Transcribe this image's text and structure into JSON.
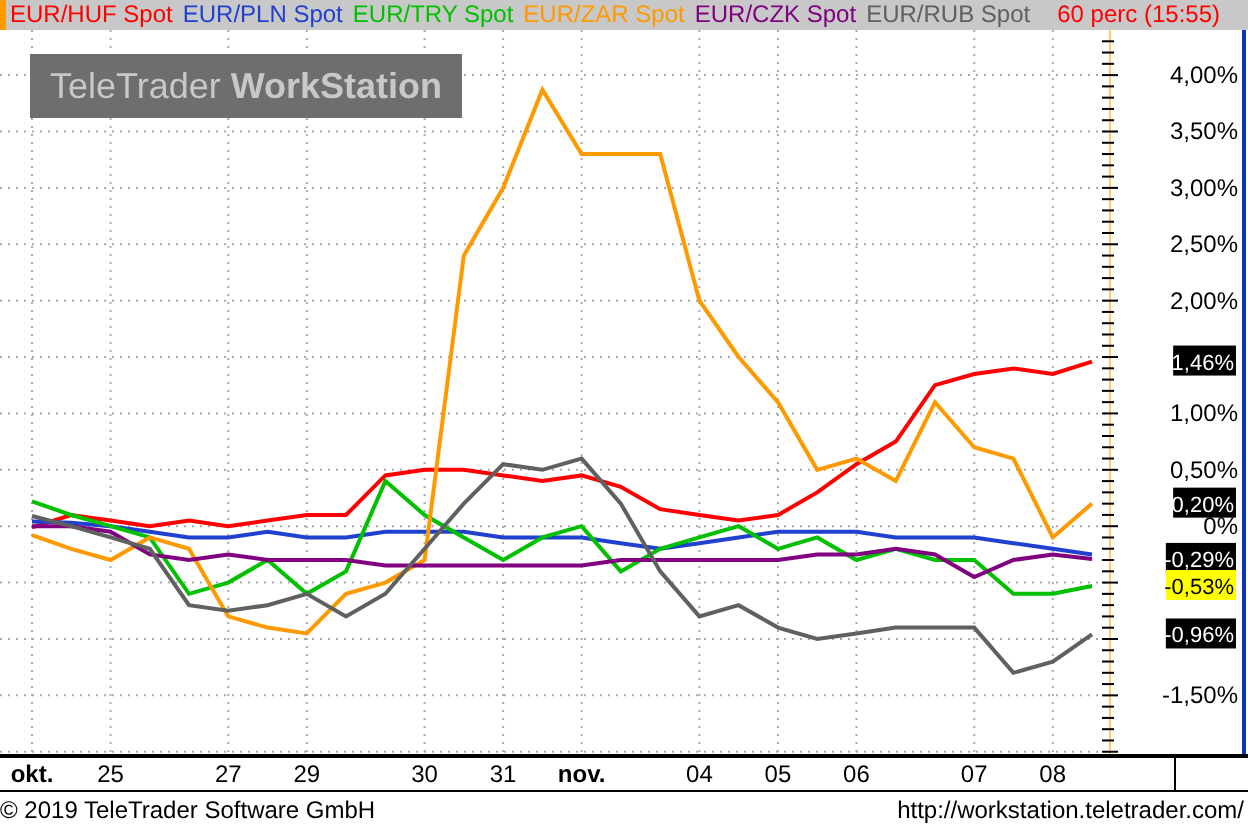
{
  "legend": {
    "interval": "60 perc (15:55)"
  },
  "logo": "TeleTrader **WorkStation**",
  "chart_data": {
    "type": "line",
    "grid": true,
    "categories": [
      "okt.",
      null,
      "25",
      null,
      null,
      "27",
      null,
      "29",
      null,
      null,
      "30",
      null,
      "31",
      null,
      "nov.",
      null,
      null,
      "04",
      null,
      "05",
      null,
      "06",
      null,
      null,
      "07",
      null,
      "08",
      null
    ],
    "series": [
      {
        "name": "EUR/HUF Spot",
        "color": "#ff0000",
        "values": [
          -0.01,
          0.1,
          0.05,
          0,
          0.05,
          0,
          0.05,
          0.1,
          0.1,
          0.45,
          0.5,
          0.5,
          0.45,
          0.4,
          0.45,
          0.35,
          0.15,
          0.1,
          0.05,
          0.1,
          0.3,
          0.55,
          0.75,
          1.25,
          1.35,
          1.4,
          1.35,
          1.46
        ]
      },
      {
        "name": "EUR/PLN Spot",
        "color": "#2040d0",
        "values": [
          0.04,
          0.03,
          0,
          -0.05,
          -0.1,
          -0.1,
          -0.05,
          -0.1,
          -0.1,
          -0.05,
          -0.05,
          -0.05,
          -0.1,
          -0.1,
          -0.1,
          -0.15,
          -0.2,
          -0.15,
          -0.1,
          -0.05,
          -0.05,
          -0.05,
          -0.1,
          -0.1,
          -0.1,
          -0.15,
          -0.2,
          -0.25
        ]
      },
      {
        "name": "EUR/TRY Spot",
        "color": "#00c000",
        "values": [
          0.22,
          0.1,
          0,
          -0.1,
          -0.6,
          -0.5,
          -0.3,
          -0.6,
          -0.4,
          0.4,
          0.1,
          -0.1,
          -0.3,
          -0.1,
          0,
          -0.4,
          -0.2,
          -0.1,
          0,
          -0.2,
          -0.1,
          -0.3,
          -0.2,
          -0.3,
          -0.3,
          -0.6,
          -0.6,
          -0.53
        ]
      },
      {
        "name": "EUR/ZAR Spot",
        "color": "#ff9900",
        "values": [
          -0.08,
          -0.2,
          -0.3,
          -0.1,
          -0.2,
          -0.8,
          -0.9,
          -0.95,
          -0.6,
          -0.5,
          -0.3,
          2.4,
          3.0,
          3.87,
          3.3,
          3.3,
          3.3,
          2.0,
          1.5,
          1.1,
          0.5,
          0.6,
          0.4,
          1.1,
          0.7,
          0.6,
          -0.1,
          0.2
        ]
      },
      {
        "name": "EUR/CZK Spot",
        "color": "#800080",
        "values": [
          0,
          0,
          -0.05,
          -0.25,
          -0.3,
          -0.25,
          -0.3,
          -0.3,
          -0.3,
          -0.35,
          -0.35,
          -0.35,
          -0.35,
          -0.35,
          -0.35,
          -0.3,
          -0.3,
          -0.3,
          -0.3,
          -0.3,
          -0.25,
          -0.25,
          -0.2,
          -0.25,
          -0.45,
          -0.3,
          -0.25,
          -0.29
        ]
      },
      {
        "name": "EUR/RUB Spot",
        "color": "#606060",
        "values": [
          0.09,
          0,
          -0.1,
          -0.2,
          -0.7,
          -0.75,
          -0.7,
          -0.6,
          -0.8,
          -0.6,
          -0.2,
          0.2,
          0.55,
          0.5,
          0.6,
          0.2,
          -0.4,
          -0.8,
          -0.7,
          -0.9,
          -1.0,
          -0.95,
          -0.9,
          -0.9,
          -0.9,
          -1.3,
          -1.2,
          -0.96
        ]
      }
    ],
    "ylim": [
      -2.02,
      4.4
    ],
    "yticks": [
      {
        "value": 4,
        "label": "4,00%"
      },
      {
        "value": 3.5,
        "label": "3,50%"
      },
      {
        "value": 3,
        "label": "3,00%"
      },
      {
        "value": 2.5,
        "label": "2,50%"
      },
      {
        "value": 2,
        "label": "2,00%"
      },
      {
        "value": 1,
        "label": "1,00%"
      },
      {
        "value": 0.5,
        "label": "0,50%"
      },
      {
        "value": 0,
        "label": "0%"
      },
      {
        "value": -1.5,
        "label": "-1,50%"
      }
    ],
    "annotations": [
      "1,46%",
      "0,20%",
      "-0,29%",
      "-0,53%",
      "-0,96%"
    ]
  },
  "value_label_states": [
    {
      "selected": false
    },
    {
      "selected": false
    },
    {
      "selected": false
    },
    {
      "selected": true
    },
    {
      "selected": false
    }
  ],
  "footer": {
    "copyright": "© 2019 TeleTrader Software GmbH",
    "url": "http://workstation.teletrader.com/"
  }
}
